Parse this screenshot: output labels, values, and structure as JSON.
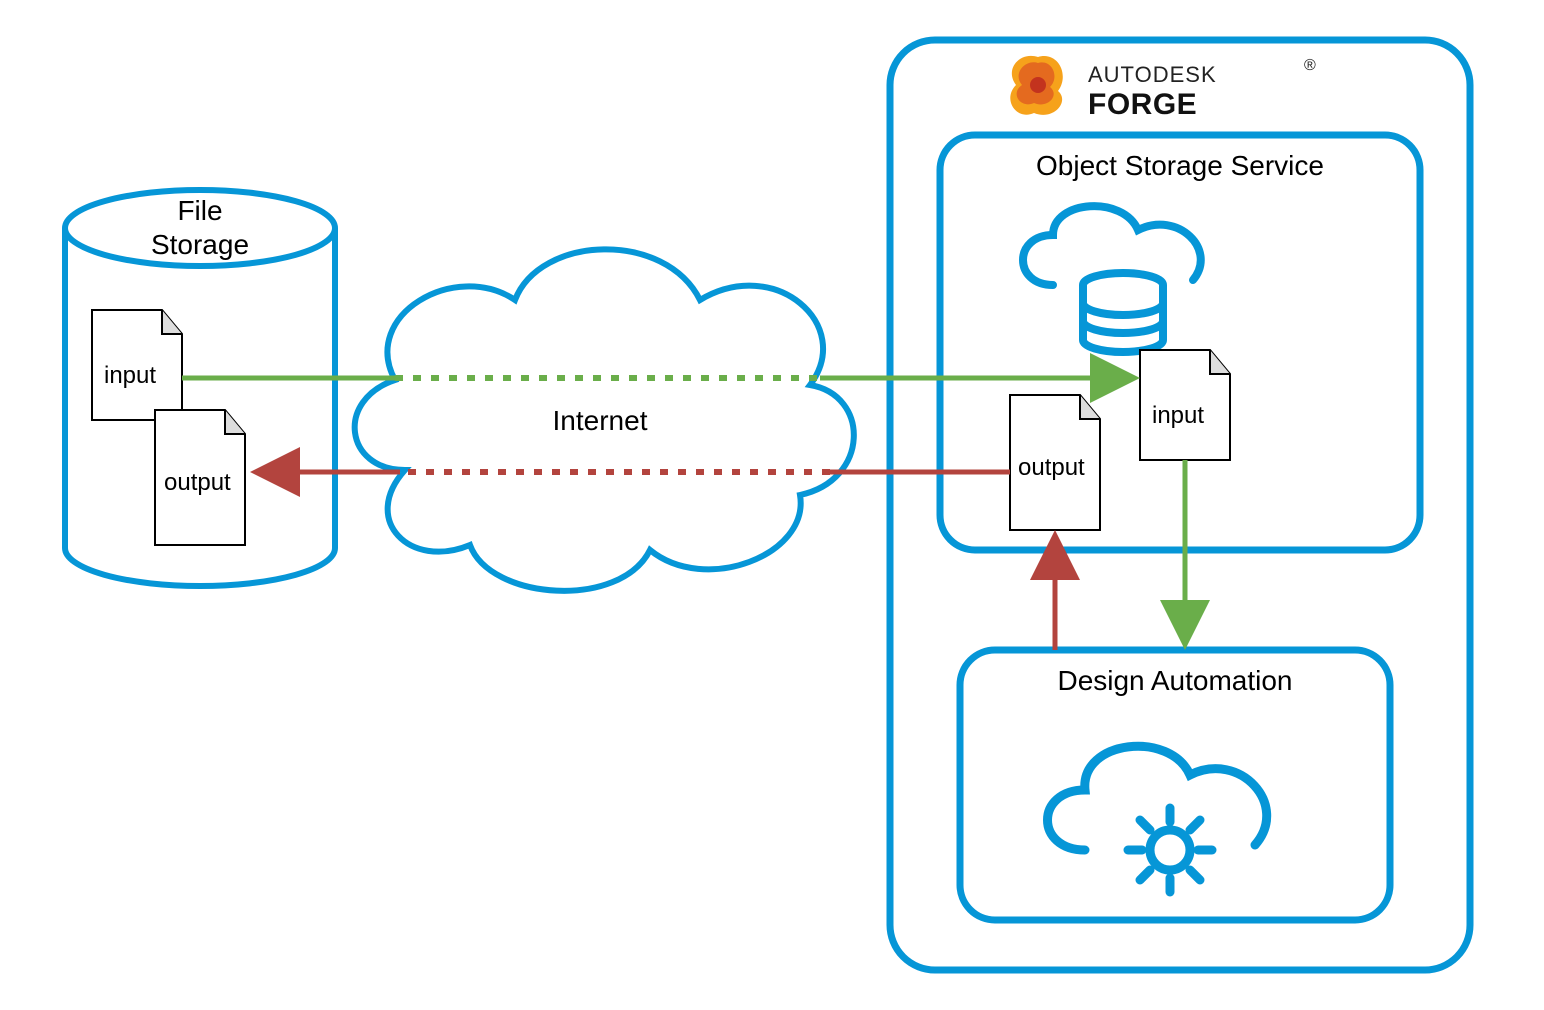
{
  "diagram": {
    "file_storage_label_1": "File",
    "file_storage_label_2": "Storage",
    "file_storage_input_label": "input",
    "file_storage_output_label": "output",
    "internet_label": "Internet",
    "brand_line1": "AUTODESK",
    "brand_line2": "FORGE",
    "oss_label": "Object Storage Service",
    "oss_input_label": "input",
    "oss_output_label": "output",
    "design_automation_label": "Design Automation",
    "colors": {
      "stroke_blue": "#0696D7",
      "arrow_green": "#6AAE4A",
      "arrow_red": "#B3443E"
    }
  }
}
